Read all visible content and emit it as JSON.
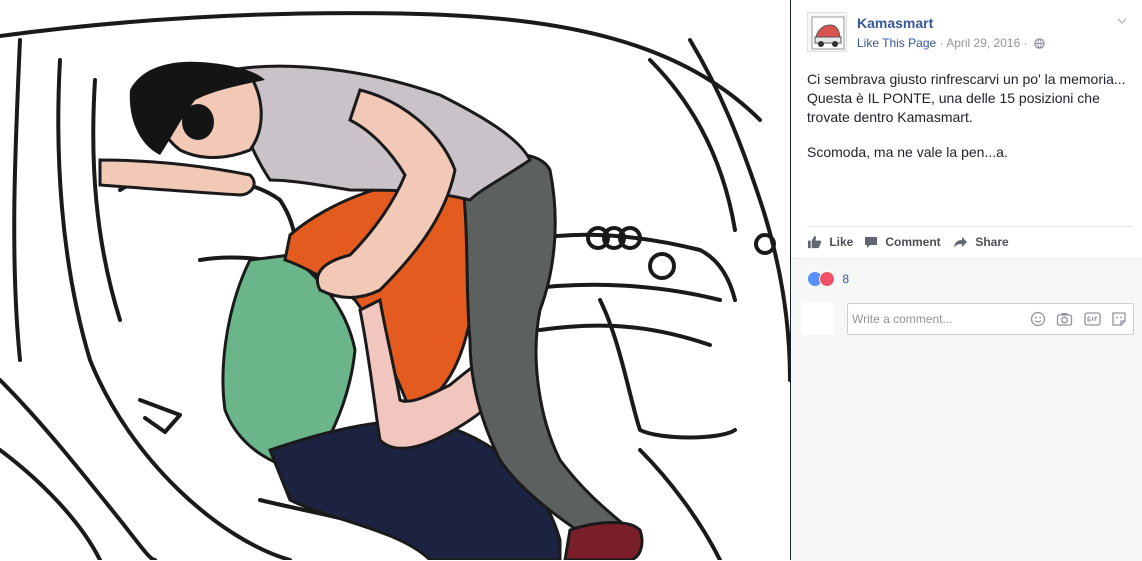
{
  "post": {
    "page_name": "Kamasmart",
    "like_page": "Like This Page",
    "separator": "·",
    "date": "April 29, 2016",
    "separator2": "·",
    "text_line1": "Ci sembrava giusto rinfrescarvi un po' la memoria...",
    "text_line2": "Questa è IL PONTE, una delle 15 posizioni che",
    "text_line3": "trovate dentro Kamasmart.",
    "text_line4": "Scomoda, ma ne vale la pen...a."
  },
  "actions": {
    "like_label": "Like",
    "comment_label": "Comment",
    "share_label": "Share"
  },
  "reactions": {
    "count": "8",
    "types": [
      "like-icon",
      "love-icon"
    ]
  },
  "comment": {
    "placeholder": "Write a comment...",
    "tools": [
      "emoji-icon",
      "camera-icon",
      "gif-icon",
      "sticker-icon"
    ]
  },
  "colors": {
    "link": "#365899",
    "meta": "#90949c",
    "text": "#1d2129",
    "like_reaction": "#5890ff",
    "love_reaction": "#f25268",
    "shirt": "#c9c3c9",
    "hair": "#e35b1f",
    "pants": "#5c6160"
  },
  "icons": {
    "globe": "globe-icon",
    "chevron": "chevron-down-icon",
    "like": "thumbs-up-icon",
    "comment": "speech-bubble-icon",
    "share": "share-arrow-icon"
  }
}
